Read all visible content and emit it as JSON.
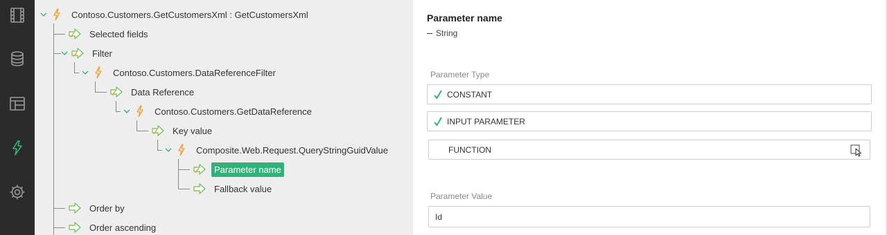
{
  "rail": {
    "items": [
      {
        "name": "film-icon"
      },
      {
        "name": "database-icon"
      },
      {
        "name": "layout-icon"
      },
      {
        "name": "lightning-icon"
      },
      {
        "name": "gear-icon"
      }
    ]
  },
  "tree": {
    "nodes": [
      {
        "label": "Contoso.Customers.GetCustomersXml : GetCustomersXml",
        "icon": "function-icon",
        "expanded": true
      },
      {
        "label": "Selected fields",
        "icon": "parameter-arrow-icon"
      },
      {
        "label": "Filter",
        "icon": "parameter-arrow-icon",
        "expanded": true
      },
      {
        "label": "Contoso.Customers.DataReferenceFilter",
        "icon": "function-icon",
        "expanded": true
      },
      {
        "label": "Data Reference",
        "icon": "parameter-arrow-icon"
      },
      {
        "label": "Contoso.Customers.GetDataReference",
        "icon": "function-icon",
        "expanded": true
      },
      {
        "label": "Key value",
        "icon": "parameter-arrow-icon"
      },
      {
        "label": "Composite.Web.Request.QueryStringGuidValue",
        "icon": "function-icon",
        "expanded": true
      },
      {
        "label": "Parameter name",
        "icon": "parameter-arrow-icon",
        "selected": true
      },
      {
        "label": "Fallback value",
        "icon": "parameter-arrow-green-icon"
      },
      {
        "label": "Order by",
        "icon": "parameter-arrow-green-icon"
      },
      {
        "label": "Order ascending",
        "icon": "parameter-arrow-green-icon"
      }
    ]
  },
  "props": {
    "title": "Parameter name",
    "type": "String",
    "type_label": "Parameter Type",
    "options": [
      {
        "label": "CONSTANT",
        "checked": true
      },
      {
        "label": "INPUT PARAMETER",
        "checked": true
      },
      {
        "label": "FUNCTION",
        "checked": false
      }
    ],
    "value_label": "Parameter Value",
    "value": "Id"
  },
  "colors": {
    "accent": "#2fb37a",
    "rail_bg": "#2b2b2b",
    "tree_bg": "#eeeeee",
    "function_icon": "#f0a030",
    "arrow_icon": "#6cc04a"
  }
}
